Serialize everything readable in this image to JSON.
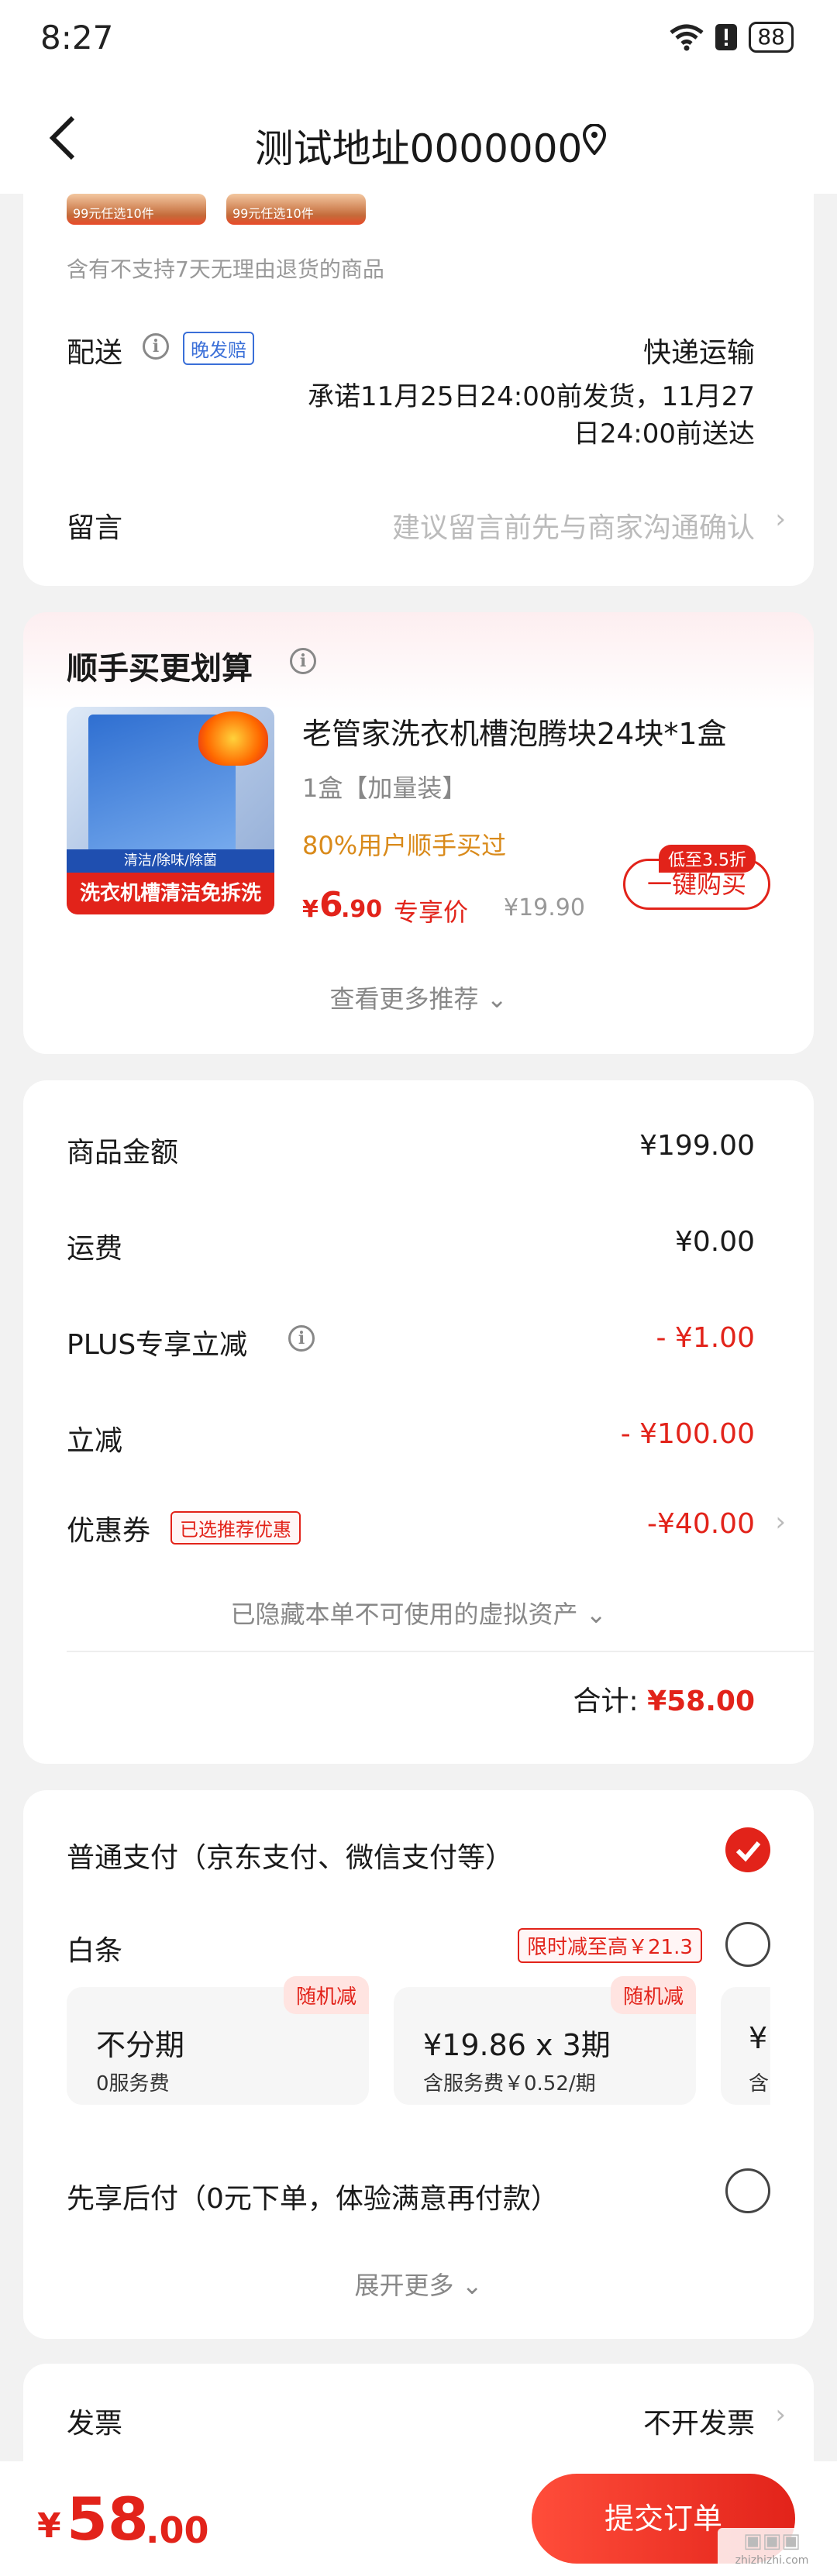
{
  "status_bar": {
    "time": "8:27",
    "battery": "88"
  },
  "header": {
    "title": "测试地址0000000"
  },
  "goods_card": {
    "thumbs": [
      {
        "price_tag": "99元任选10件"
      },
      {
        "price_tag": "99元任选10件"
      }
    ],
    "no_return_note": "含有不支持7天无理由退货的商品",
    "delivery_label": "配送",
    "delivery_tag": "晚发赔",
    "delivery_method": "快递运输",
    "delivery_promise_line1": "承诺11月25日24:00前发货，11月27",
    "delivery_promise_line2": "日24:00前送达",
    "message_label": "留言",
    "message_placeholder": "建议留言前先与商家沟通确认"
  },
  "addon_card": {
    "title": "顺手买更划算",
    "product": {
      "name": "老管家洗衣机槽泡腾块24块*1盒",
      "spec": "1盒【加量装】",
      "social_proof": "80%用户顺手买过",
      "price_symbol": "¥",
      "price_int": "6",
      "price_dec": ".90",
      "price_label": "专享价",
      "original_price": "¥19.90",
      "discount_badge": "低至3.5折",
      "buy_button": "一键购买",
      "image_band": "洗衣机槽清洁免拆洗",
      "image_band_small": "清洁/除味/除菌"
    },
    "more_link": "查看更多推荐"
  },
  "summary_card": {
    "rows": [
      {
        "label": "商品金额",
        "value": "¥199.00"
      },
      {
        "label": "运费",
        "value": "¥0.00"
      },
      {
        "label": "PLUS专享立减",
        "value": "- ¥1.00"
      },
      {
        "label": "立减",
        "value": "- ¥100.00"
      }
    ],
    "coupon_label": "优惠券",
    "coupon_tag": "已选推荐优惠",
    "coupon_value": "-¥40.00",
    "hidden_assets": "已隐藏本单不可使用的虚拟资产",
    "total_label": "合计:",
    "total_value": "¥58.00"
  },
  "payment_card": {
    "normal_pay": "普通支付（京东支付、微信支付等）",
    "baitiao_label": "白条",
    "baitiao_promo": "限时减至高￥21.3",
    "plans": [
      {
        "badge": "随机减",
        "title": "不分期",
        "sub": "0服务费"
      },
      {
        "badge": "随机减",
        "title": "¥19.86 x 3期",
        "sub": "含服务费￥0.52/期"
      },
      {
        "badge": "",
        "title": "¥",
        "sub": "含"
      }
    ],
    "pay_later": "先享后付（0元下单，体验满意再付款）",
    "expand_more": "展开更多"
  },
  "invoice_card": {
    "label": "发票",
    "value": "不开发票"
  },
  "bottom_bar": {
    "total_symbol": "¥",
    "total_int": "58",
    "total_dec": ".00",
    "submit_label": "提交订单"
  },
  "watermark": {
    "text": "zhizhizhi.com"
  },
  "colors": {
    "accent": "#e2231a",
    "background": "#f2f2f2",
    "link_blue": "#3a6fd8"
  },
  "icons": [
    "back-icon",
    "location-icon",
    "wifi-icon",
    "alert-icon",
    "battery-icon",
    "info-icon",
    "chevron-right-icon",
    "chevron-down-icon",
    "checkmark-icon"
  ]
}
